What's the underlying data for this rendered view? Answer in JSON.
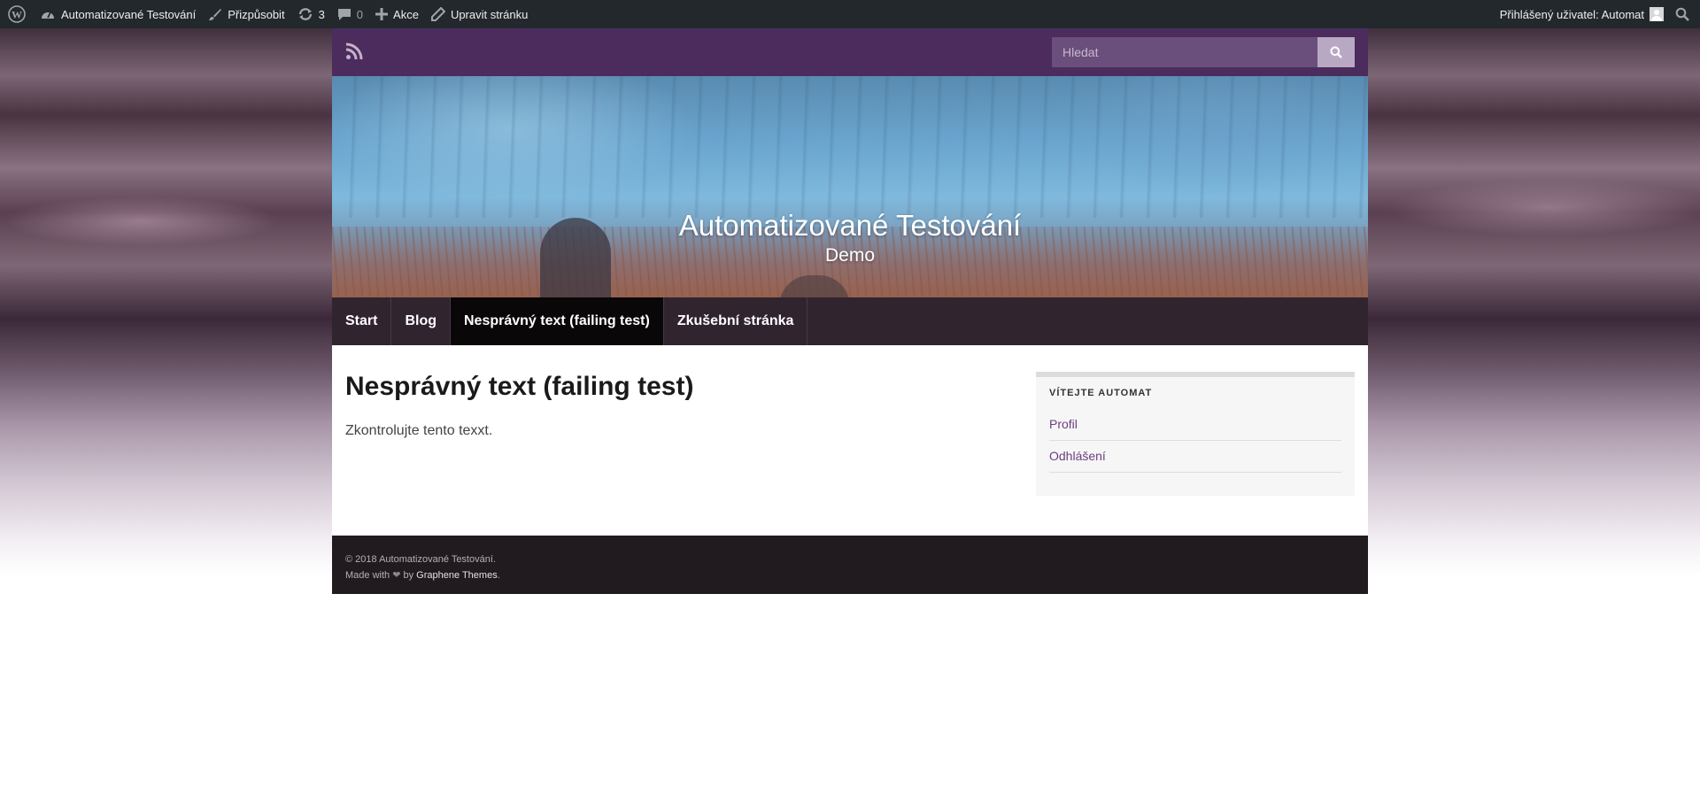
{
  "adminbar": {
    "wp_logo": "wordpress-icon",
    "site_name": "Automatizované Testování",
    "customize": "Přizpůsobit",
    "updates_count": "3",
    "comments_count": "0",
    "new_label": "Akce",
    "edit_page": "Upravit stránku",
    "user_greeting": "Přihlášený uživatel: Automat"
  },
  "topbar": {
    "search_placeholder": "Hledat"
  },
  "header": {
    "site_title": "Automatizované Testování",
    "site_description": "Demo"
  },
  "nav": {
    "items": [
      {
        "label": "Start"
      },
      {
        "label": "Blog"
      },
      {
        "label": "Nesprávný text (failing test)",
        "active": true
      },
      {
        "label": "Zkušební stránka"
      }
    ]
  },
  "content": {
    "title": "Nesprávný text (failing test)",
    "text": "Zkontrolujte tento texxt."
  },
  "widget": {
    "title": "VÍTEJTE AUTOMAT",
    "links": [
      {
        "label": "Profil"
      },
      {
        "label": "Odhlášení"
      }
    ]
  },
  "footer": {
    "copyright": "© 2018 Automatizované Testování.",
    "made_with": "Made with",
    "by": "by",
    "theme_name": "Graphene Themes"
  },
  "colors": {
    "adminbar_bg": "#23282d",
    "topbar_bg": "#4b2c5c",
    "nav_bg": "#30242f",
    "nav_active_bg": "#0a0709",
    "link": "#6b3d83",
    "footer_bg": "#211b20"
  }
}
